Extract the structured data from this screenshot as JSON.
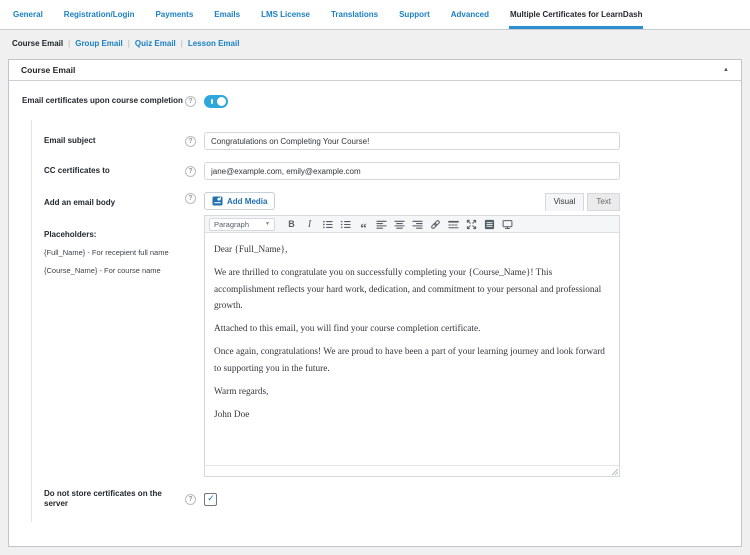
{
  "colors": {
    "accent_blue": "#1b80c4",
    "tab_underline": "#2e8fd0",
    "toggle_on_blue": "#2ea7dc",
    "check_blue": "#2271b1",
    "page_background": "#f0f0f1",
    "panel_border": "#c3c4c7"
  },
  "glyphs": {
    "help": "?",
    "check": "✓",
    "collapse": "▲",
    "select_arrow": "▼",
    "bold": "B",
    "italic": "I",
    "quote": "“"
  },
  "header": {
    "tabs": [
      {
        "label": "General",
        "active": false
      },
      {
        "label": "Registration/Login",
        "active": false
      },
      {
        "label": "Payments",
        "active": false
      },
      {
        "label": "Emails",
        "active": false
      },
      {
        "label": "LMS License",
        "active": false
      },
      {
        "label": "Translations",
        "active": false
      },
      {
        "label": "Support",
        "active": false
      },
      {
        "label": "Advanced",
        "active": false
      },
      {
        "label": "Multiple Certificates for LearnDash",
        "active": true
      }
    ]
  },
  "subnav": {
    "separator": "|",
    "items": [
      {
        "label": "Course Email",
        "active": true
      },
      {
        "label": "Group Email",
        "active": false
      },
      {
        "label": "Quiz Email",
        "active": false
      },
      {
        "label": "Lesson Email",
        "active": false
      }
    ]
  },
  "panel": {
    "title": "Course Email",
    "toggle_row": {
      "label": "Email certificates upon course completion",
      "state": "on"
    },
    "subject_row": {
      "label": "Email subject",
      "value": "Congratulations on Completing Your Course!"
    },
    "cc_row": {
      "label": "CC certificates to",
      "value": "jane@example.com, emily@example.com"
    },
    "body_row": {
      "label": "Add an email body"
    },
    "placeholders": {
      "title": "Placeholders:",
      "items": [
        "{Full_Name} - For recepient full name",
        "{Course_Name} - For course name"
      ]
    },
    "store_row": {
      "label": "Do not store certificates on the server",
      "checked": true
    }
  },
  "editor": {
    "add_media_label": "Add Media",
    "visual_tab_label": "Visual",
    "text_tab_label": "Text",
    "format_label": "Paragraph",
    "paragraphs": [
      "Dear {Full_Name},",
      "We are thrilled to congratulate you on successfully completing your {Course_Name}! This accomplishment reflects your hard work, dedication, and commitment to your personal and professional growth.",
      "Attached to this email, you will find your course completion certificate.",
      "Once again, congratulations! We are proud to have been a part of your learning journey and look forward to supporting you in the future.",
      "Warm regards,",
      "John Doe"
    ]
  }
}
